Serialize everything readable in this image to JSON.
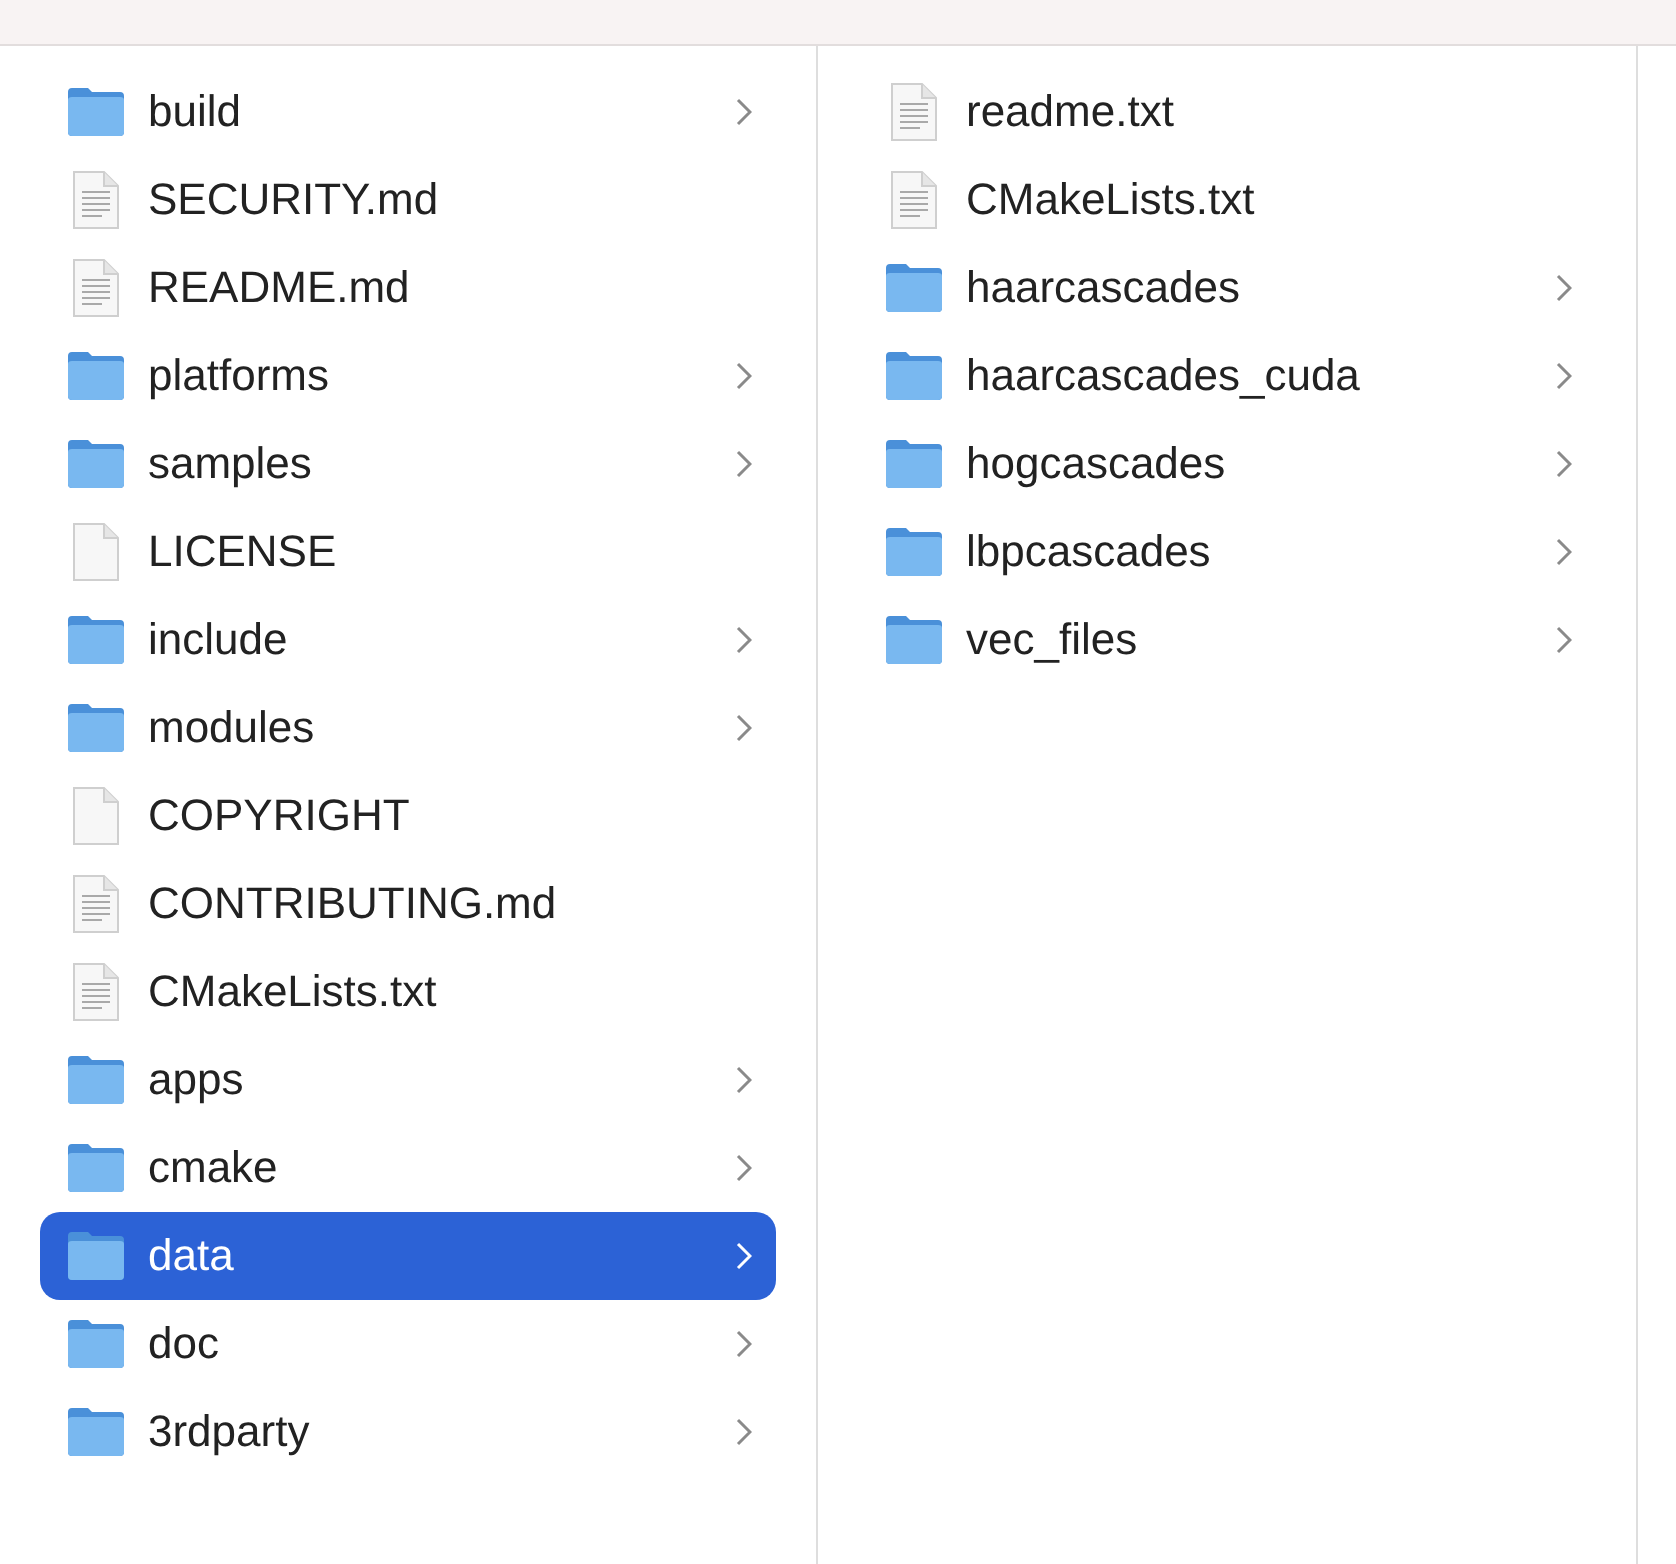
{
  "columns": [
    {
      "items": [
        {
          "name": "build",
          "kind": "folder",
          "selected": false
        },
        {
          "name": "SECURITY.md",
          "kind": "document",
          "selected": false
        },
        {
          "name": "README.md",
          "kind": "document",
          "selected": false
        },
        {
          "name": "platforms",
          "kind": "folder",
          "selected": false
        },
        {
          "name": "samples",
          "kind": "folder",
          "selected": false
        },
        {
          "name": "LICENSE",
          "kind": "blank",
          "selected": false
        },
        {
          "name": "include",
          "kind": "folder",
          "selected": false
        },
        {
          "name": "modules",
          "kind": "folder",
          "selected": false
        },
        {
          "name": "COPYRIGHT",
          "kind": "blank",
          "selected": false
        },
        {
          "name": "CONTRIBUTING.md",
          "kind": "document",
          "selected": false
        },
        {
          "name": "CMakeLists.txt",
          "kind": "document",
          "selected": false
        },
        {
          "name": "apps",
          "kind": "folder",
          "selected": false
        },
        {
          "name": "cmake",
          "kind": "folder",
          "selected": false
        },
        {
          "name": "data",
          "kind": "folder",
          "selected": true
        },
        {
          "name": "doc",
          "kind": "folder",
          "selected": false
        },
        {
          "name": "3rdparty",
          "kind": "folder",
          "selected": false
        }
      ]
    },
    {
      "items": [
        {
          "name": "readme.txt",
          "kind": "document",
          "selected": false
        },
        {
          "name": "CMakeLists.txt",
          "kind": "document",
          "selected": false
        },
        {
          "name": "haarcascades",
          "kind": "folder",
          "selected": false
        },
        {
          "name": "haarcascades_cuda",
          "kind": "folder",
          "selected": false
        },
        {
          "name": "hogcascades",
          "kind": "folder",
          "selected": false
        },
        {
          "name": "lbpcascades",
          "kind": "folder",
          "selected": false
        },
        {
          "name": "vec_files",
          "kind": "folder",
          "selected": false
        }
      ]
    }
  ]
}
